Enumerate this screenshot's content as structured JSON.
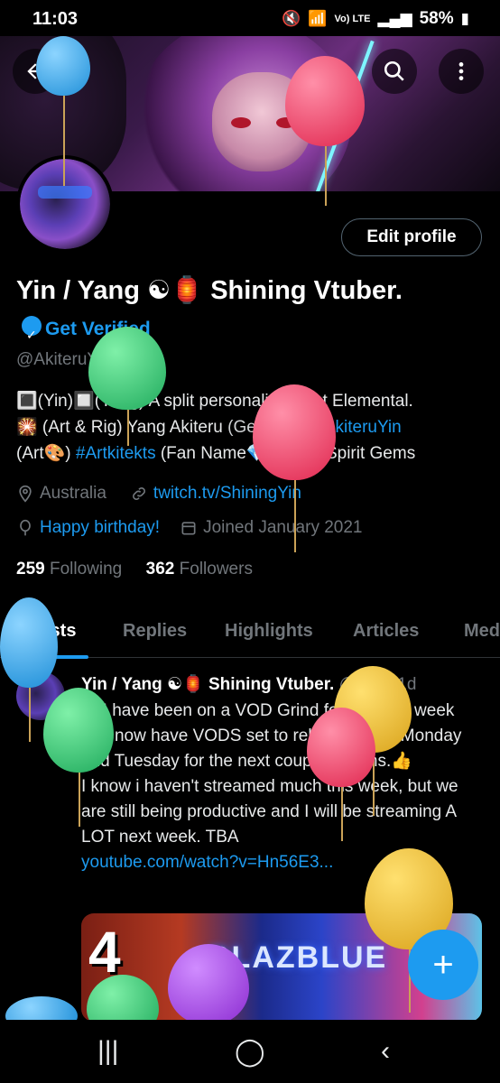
{
  "status_bar": {
    "time": "11:03",
    "network": "Vo) LTE",
    "battery": "58%"
  },
  "header": {
    "back_icon": "arrow-left-icon",
    "search_icon": "search-icon",
    "more_icon": "more-vertical-icon"
  },
  "profile": {
    "edit_button": "Edit profile",
    "name": "Yin / Yang ☯🏮 Shining Vtuber.",
    "get_verified": "Get Verified",
    "handle": "@AkiteruYin",
    "bio_line1": "🔳(Yin)🔲(Yang) A split personality, Light Elemental.",
    "bio_line2_a": "🎇 (Art & Rig) Yang Akiteru ",
    "bio_line2_b": "(General#)",
    "bio_line2_c": " #AkiteruYin",
    "bio_line3_a": "(Art🎨) ",
    "bio_line3_b": "#Artkitekts",
    "bio_line3_c": " (Fan Name💎) Shiny Spirit Gems",
    "location": "Australia",
    "website": "twitch.tv/ShiningYin",
    "birthday": "Happy birthday!",
    "joined": "Joined January 2021",
    "following_count": "259",
    "following_label": "Following",
    "followers_count": "362",
    "followers_label": "Followers"
  },
  "tabs": [
    "Posts",
    "Replies",
    "Highlights",
    "Articles",
    "Media"
  ],
  "post": {
    "author": "Yin / Yang ☯🏮 Shining Vtuber.",
    "handle_time": "@A... · 1d",
    "line1": "🔲I have been on a VOD Grind for the past week and now have VODS set to release every Monday and Tuesday for the next couple months.👍",
    "line2": "I know i haven't streamed much this week, but we are still being productive and I will be streaming A LOT next week. TBA",
    "link": "youtube.com/watch?v=Hn56E3...",
    "media_number": "4",
    "media_logo": "BLAZBLUE"
  },
  "fab_label": "+",
  "nav": {
    "recents": "|||",
    "home": "◯",
    "back": "‹"
  },
  "colors": {
    "accent": "#1d9bf0",
    "background": "#000000",
    "muted": "#71767b"
  }
}
